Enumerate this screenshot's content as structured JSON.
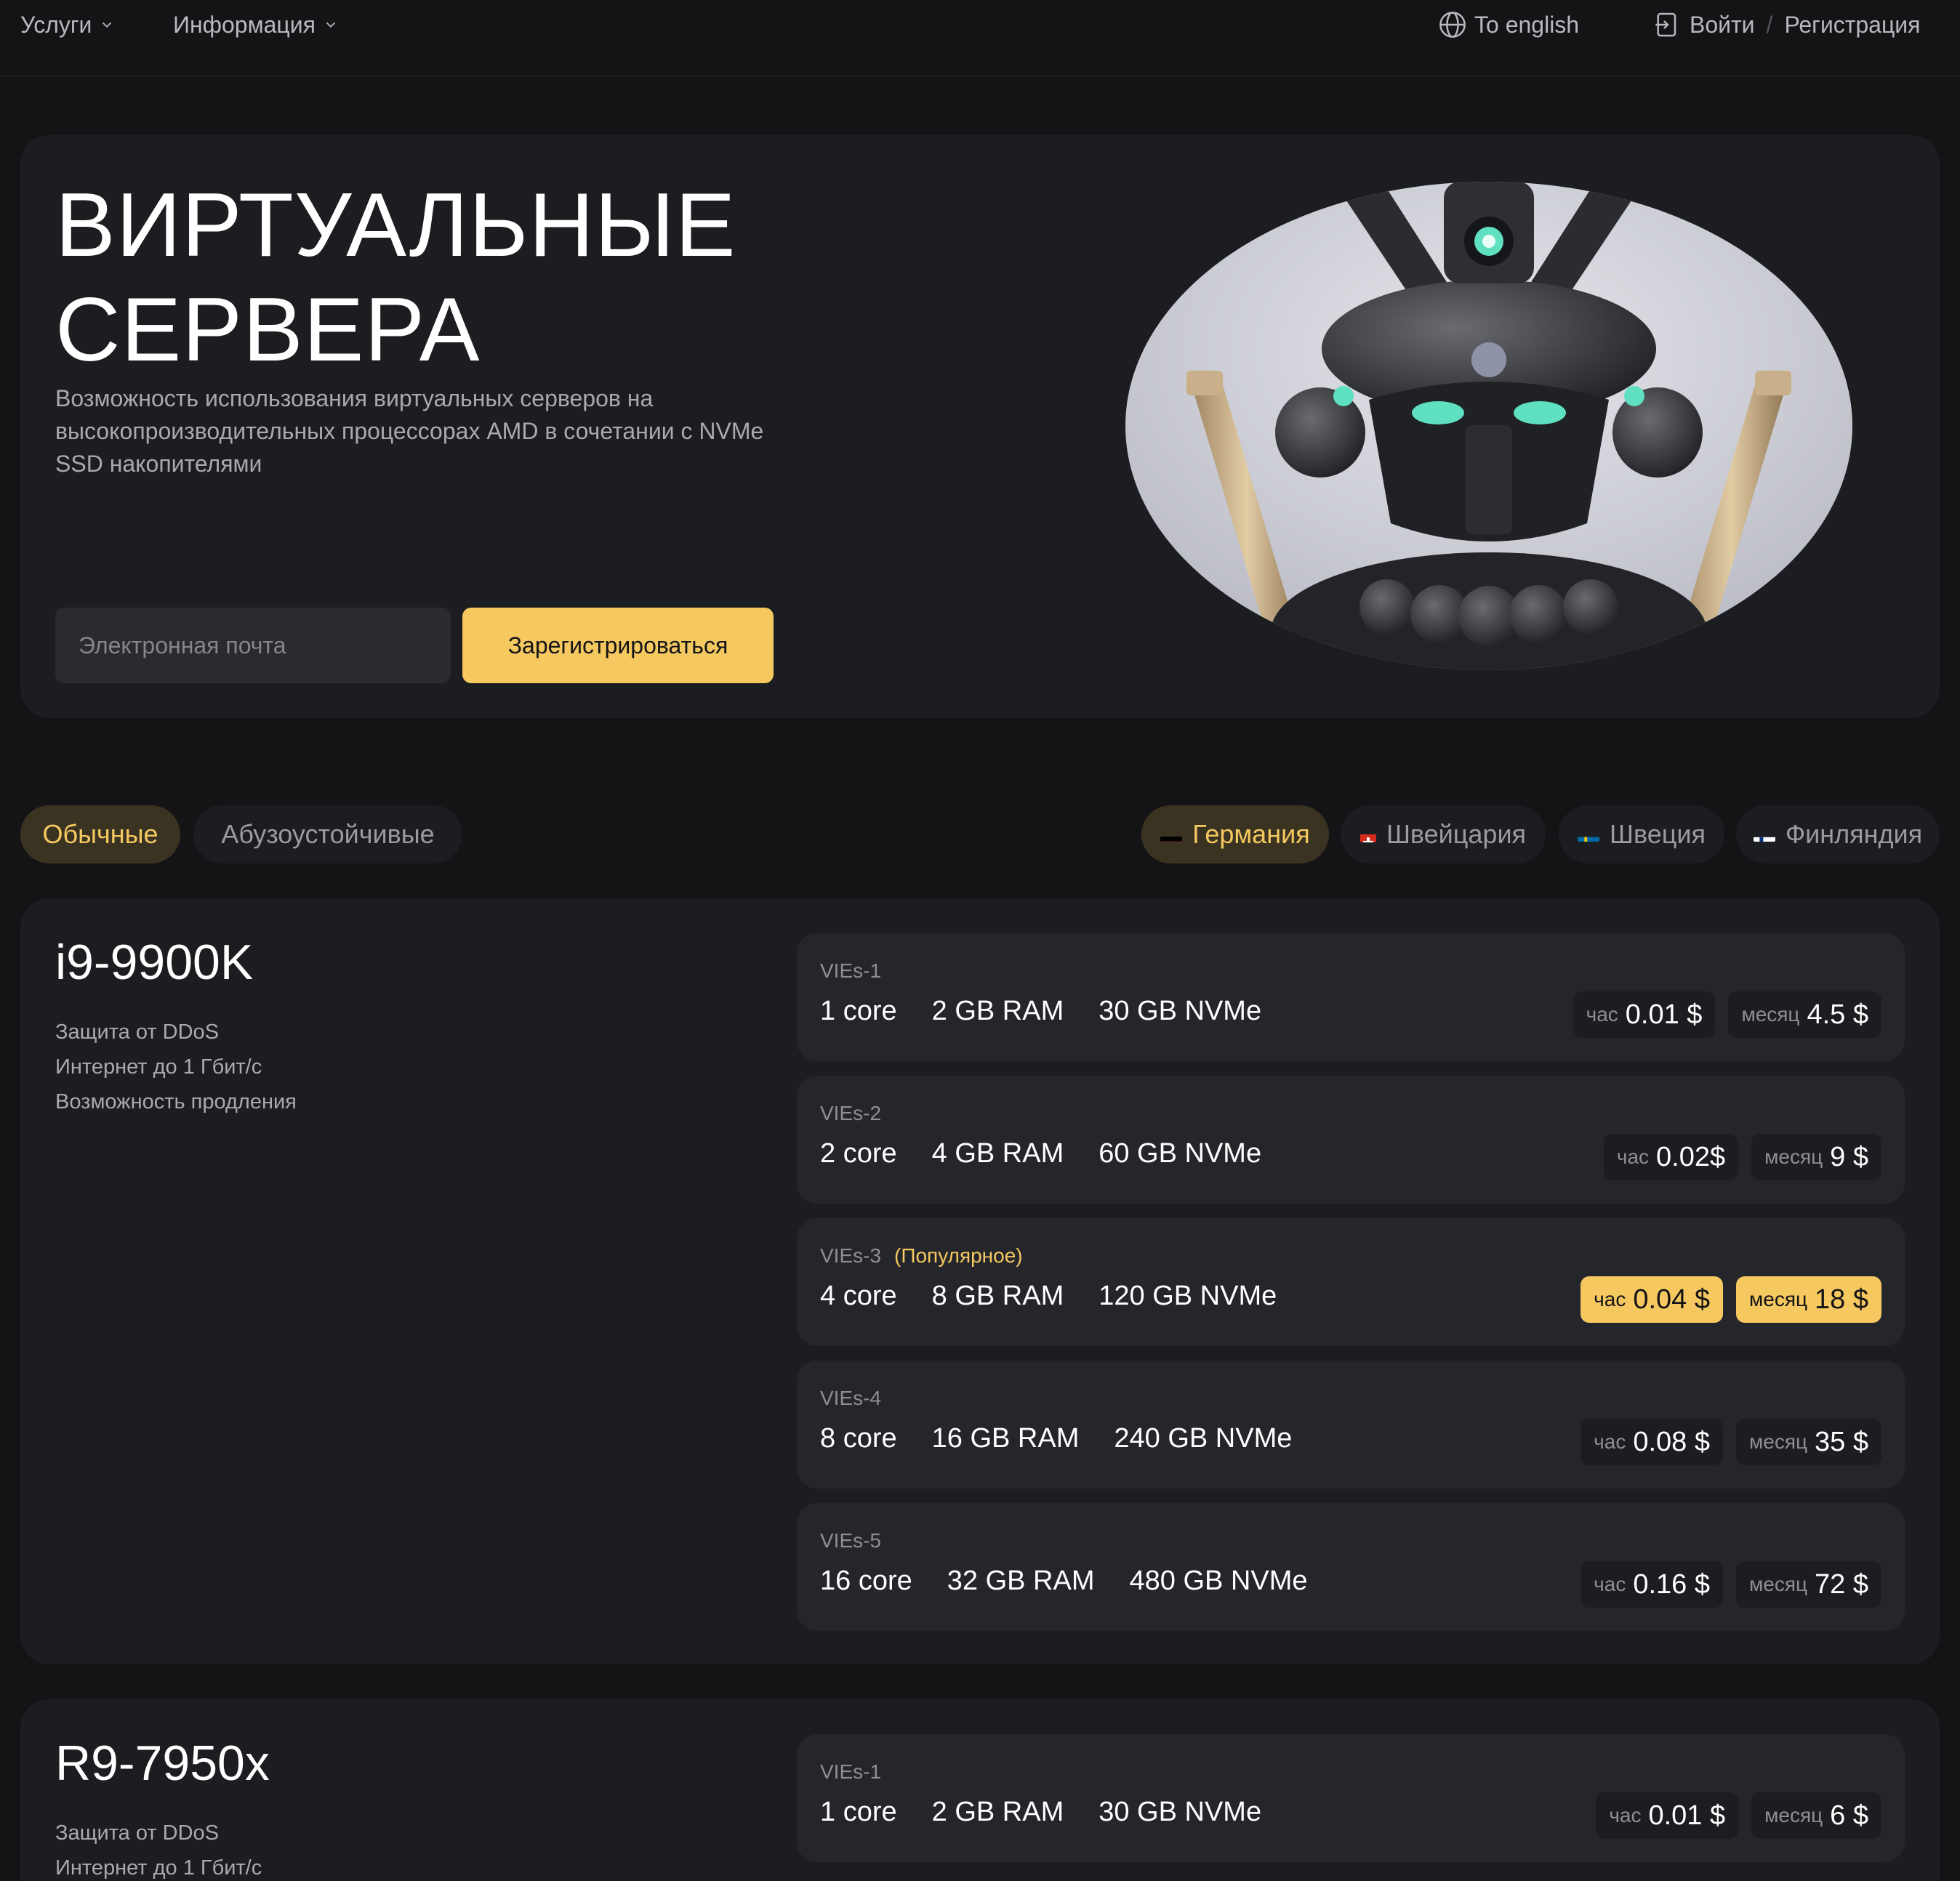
{
  "header": {
    "nav": [
      {
        "label": "Услуги"
      },
      {
        "label": "Информация"
      }
    ],
    "language": "To english",
    "login": "Войти",
    "separator": "/",
    "register": "Регистрация"
  },
  "hero": {
    "title_line1": "ВИРТУАЛЬНЫЕ",
    "title_line2": "СЕРВЕРА",
    "description": "Возможность использования виртуальных серверов на высокопроизводительных процессорах AMD в сочетании с NVMe SSD накопителями",
    "email_placeholder": "Электронная почта",
    "email_value": "",
    "register_button": "Зарегистрироваться"
  },
  "filters": {
    "types": [
      {
        "label": "Обычные",
        "active": true
      },
      {
        "label": "Абузоустойчивые",
        "active": false
      }
    ],
    "countries": [
      {
        "label": "Германия",
        "flag": "de",
        "active": true
      },
      {
        "label": "Швейцария",
        "flag": "ch",
        "active": false
      },
      {
        "label": "Швеция",
        "flag": "se",
        "active": false
      },
      {
        "label": "Финляндия",
        "flag": "fi",
        "active": false
      }
    ]
  },
  "products": [
    {
      "title": "i9-9900K",
      "features": [
        "Защита от DDoS",
        "Интернет до 1 Гбит/с",
        "Возможность продления"
      ],
      "plans": [
        {
          "name": "VIEs-1",
          "popular": "",
          "cores": "1 core",
          "ram": "2 GB RAM",
          "disk": "30 GB NVMe",
          "hour_label": "час",
          "hour_price": "0.01 $",
          "month_label": "месяц",
          "month_price": "4.5 $",
          "highlight": false
        },
        {
          "name": "VIEs-2",
          "popular": "",
          "cores": "2 core",
          "ram": "4 GB RAM",
          "disk": "60 GB NVMe",
          "hour_label": "час",
          "hour_price": "0.02$",
          "month_label": "месяц",
          "month_price": "9 $",
          "highlight": false
        },
        {
          "name": "VIEs-3",
          "popular": "(Популярное)",
          "cores": "4 core",
          "ram": "8 GB RAM",
          "disk": "120 GB NVMe",
          "hour_label": "час",
          "hour_price": "0.04 $",
          "month_label": "месяц",
          "month_price": "18 $",
          "highlight": true
        },
        {
          "name": "VIEs-4",
          "popular": "",
          "cores": "8 core",
          "ram": "16 GB RAM",
          "disk": "240 GB NVMe",
          "hour_label": "час",
          "hour_price": "0.08 $",
          "month_label": "месяц",
          "month_price": "35 $",
          "highlight": false
        },
        {
          "name": "VIEs-5",
          "popular": "",
          "cores": "16 core",
          "ram": "32 GB RAM",
          "disk": "480 GB NVMe",
          "hour_label": "час",
          "hour_price": "0.16 $",
          "month_label": "месяц",
          "month_price": "72 $",
          "highlight": false
        }
      ]
    },
    {
      "title": "R9-7950x",
      "features": [
        "Защита от DDoS",
        "Интернет до 1 Гбит/с"
      ],
      "plans": [
        {
          "name": "VIEs-1",
          "popular": "",
          "cores": "1 core",
          "ram": "2 GB RAM",
          "disk": "30 GB NVMe",
          "hour_label": "час",
          "hour_price": "0.01 $",
          "month_label": "месяц",
          "month_price": "6 $",
          "highlight": false
        }
      ]
    }
  ],
  "colors": {
    "background": "#141416",
    "card": "#1c1d21",
    "accent": "#f5c860"
  }
}
